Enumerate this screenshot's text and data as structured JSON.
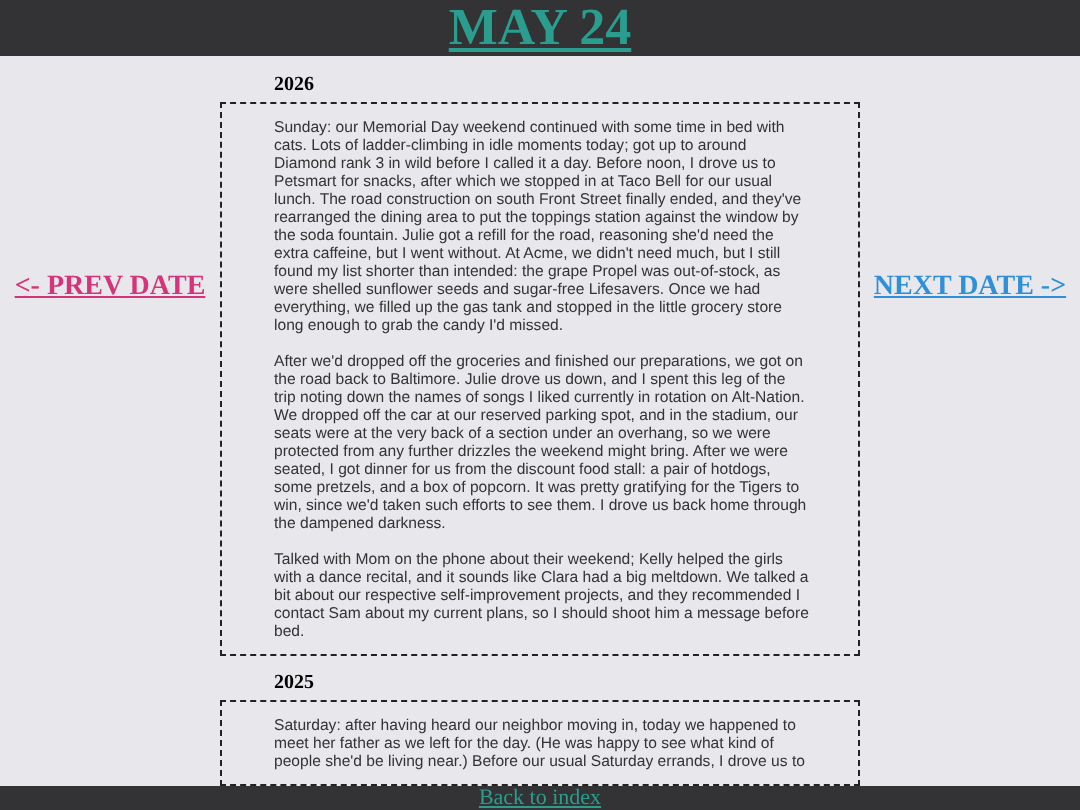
{
  "title": "MAY 24",
  "prev_link": "<- PREV DATE",
  "next_link": "NEXT DATE ->",
  "entries": [
    {
      "year": "2026",
      "paragraphs": [
        "Sunday: our Memorial Day weekend continued with some time in bed with cats. Lots of ladder-climbing in idle moments today; got up to around Diamond rank 3 in wild before I called it a day. Before noon, I drove us to Petsmart for snacks, after which we stopped in at Taco Bell for our usual lunch. The road construction on south Front Street finally ended, and they've rearranged the dining area to put the toppings station against the window by the soda fountain. Julie got a refill for the road, reasoning she'd need the extra caffeine, but I went without. At Acme, we didn't need much, but I still found my list shorter than intended: the grape Propel was out-of-stock, as were shelled sunflower seeds and sugar-free Lifesavers. Once we had everything, we filled up the gas tank and stopped in the little grocery store long enough to grab the candy I'd missed.",
        "After we'd dropped off the groceries and finished our preparations, we got on the road back to Baltimore. Julie drove us down, and I spent this leg of the trip noting down the names of songs I liked currently in rotation on Alt-Nation. We dropped off the car at our reserved parking spot, and in the stadium, our seats were at the very back of a section under an overhang, so we were protected from any further drizzles the weekend might bring. After we were seated, I got dinner for us from the discount food stall: a pair of hotdogs, some pretzels, and a box of popcorn. It was pretty gratifying for the Tigers to win, since we'd taken such efforts to see them. I drove us back home through the dampened darkness.",
        "Talked with Mom on the phone about their weekend; Kelly helped the girls with a dance recital, and it sounds like Clara had a big meltdown. We talked a bit about our respective self-improvement projects, and they recommended I contact Sam about my current plans, so I should shoot him a message before bed."
      ]
    },
    {
      "year": "2025",
      "paragraphs": [
        "Saturday: after having heard our neighbor moving in, today we happened to meet her father as we left for the day. (He was happy to see what kind of people she'd be living near.) Before our usual Saturday errands, I drove us to"
      ]
    }
  ],
  "footer_link": "Back to index"
}
